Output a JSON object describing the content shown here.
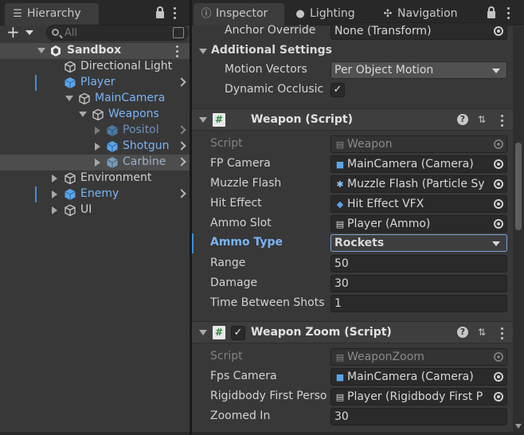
{
  "hierarchy": {
    "tab_label": "Hierarchy",
    "search_placeholder": "All",
    "tree": [
      {
        "label": "Sandbox",
        "icon": "unity-scene-icon",
        "expanded": true
      },
      {
        "label": "Directional Light",
        "icon": "gameobject-icon"
      },
      {
        "label": "Player",
        "icon": "prefab-icon",
        "has_children": true
      },
      {
        "label": "MainCamera",
        "icon": "gameobject-icon",
        "expanded": true
      },
      {
        "label": "Weapons",
        "icon": "gameobject-icon",
        "expanded": true
      },
      {
        "label": "Positol",
        "icon": "prefab-icon",
        "inactive": true
      },
      {
        "label": "Shotgun",
        "icon": "prefab-icon"
      },
      {
        "label": "Carbine",
        "icon": "prefab-icon",
        "selected": true
      },
      {
        "label": "Environment",
        "icon": "gameobject-icon"
      },
      {
        "label": "Enemy",
        "icon": "prefab-icon"
      },
      {
        "label": "UI",
        "icon": "gameobject-icon"
      }
    ]
  },
  "inspector": {
    "tabs": [
      {
        "label": "Inspector",
        "icon": "info-icon"
      },
      {
        "label": "Lighting",
        "icon": "bulb-icon"
      },
      {
        "label": "Navigation",
        "icon": "navigation-icon"
      }
    ],
    "top_rows": {
      "anchor_override_label": "Anchor Override",
      "anchor_override_value": "None (Transform)",
      "additional_settings": "Additional Settings",
      "motion_vectors_label": "Motion Vectors",
      "motion_vectors_value": "Per Object Motion",
      "dynamic_occlusion_label": "Dynamic Occlusic",
      "dynamic_occlusion_checked": "✓"
    },
    "weapon": {
      "title": "Weapon (Script)",
      "script_label": "Script",
      "script_value": "Weapon",
      "fp_camera_label": "FP Camera",
      "fp_camera_value": "MainCamera (Camera)",
      "muzzle_flash_label": "Muzzle Flash",
      "muzzle_flash_value": "Muzzle Flash (Particle Sy",
      "hit_effect_label": "Hit Effect",
      "hit_effect_value": "Hit Effect VFX",
      "ammo_slot_label": "Ammo Slot",
      "ammo_slot_value": "Player (Ammo)",
      "ammo_type_label": "Ammo Type",
      "ammo_type_value": "Rockets",
      "range_label": "Range",
      "range_value": "50",
      "damage_label": "Damage",
      "damage_value": "30",
      "time_label": "Time Between Shots",
      "time_value": "1"
    },
    "weapon_zoom": {
      "title": "Weapon Zoom (Script)",
      "enabled": "✓",
      "script_label": "Script",
      "script_value": "WeaponZoom",
      "fps_camera_label": "Fps Camera",
      "fps_camera_value": "MainCamera (Camera)",
      "rigidbody_label": "Rigidbody First Perso",
      "rigidbody_value": "Player (Rigidbody First P",
      "zoomed_in_label": "Zoomed In",
      "zoomed_in_value": "30"
    }
  }
}
